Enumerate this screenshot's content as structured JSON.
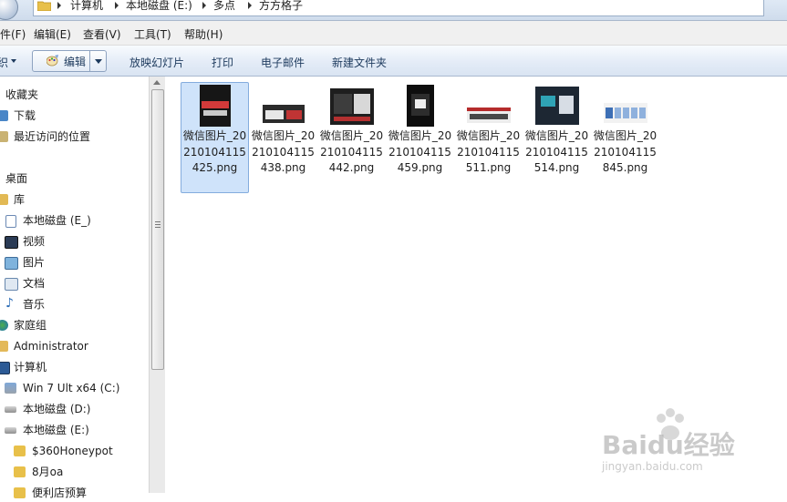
{
  "breadcrumb": [
    "计算机",
    "本地磁盘 (E:)",
    "多点",
    "方方格子"
  ],
  "menu": [
    "件(F)",
    "编辑(E)",
    "查看(V)",
    "工具(T)",
    "帮助(H)"
  ],
  "commands": {
    "left_cut": "织",
    "edit": "编辑",
    "slideshow": "放映幻灯片",
    "print": "打印",
    "email": "电子邮件",
    "newfolder": "新建文件夹"
  },
  "nav": [
    {
      "label": "收藏夹",
      "icon": "favorites-star-icon"
    },
    {
      "label": "下载",
      "icon": "downloads-icon"
    },
    {
      "label": "最近访问的位置",
      "icon": "recent-places-icon"
    },
    {
      "label": "桌面",
      "icon": "desktop-icon"
    },
    {
      "label": "库",
      "icon": "library-icon"
    },
    {
      "label": "本地磁盘 (E_)",
      "icon": "drive-link-icon"
    },
    {
      "label": "视频",
      "icon": "video-library-icon"
    },
    {
      "label": "图片",
      "icon": "pictures-library-icon"
    },
    {
      "label": "文档",
      "icon": "documents-library-icon"
    },
    {
      "label": "音乐",
      "icon": "music-library-icon"
    },
    {
      "label": "家庭组",
      "icon": "homegroup-icon"
    },
    {
      "label": "Administrator",
      "icon": "user-folder-icon"
    },
    {
      "label": "计算机",
      "icon": "computer-icon"
    },
    {
      "label": "Win 7 Ult x64 (C:)",
      "icon": "system-drive-icon"
    },
    {
      "label": "本地磁盘 (D:)",
      "icon": "hard-drive-icon"
    },
    {
      "label": "本地磁盘 (E:)",
      "icon": "hard-drive-icon"
    },
    {
      "label": "$360Honeypot",
      "icon": "folder-icon"
    },
    {
      "label": "8月oa",
      "icon": "folder-icon"
    },
    {
      "label": "便利店预算",
      "icon": "folder-icon"
    }
  ],
  "files": [
    {
      "name": "微信图片_20210104115425.png",
      "selected": true
    },
    {
      "name": "微信图片_20210104115438.png",
      "selected": false
    },
    {
      "name": "微信图片_20210104115442.png",
      "selected": false
    },
    {
      "name": "微信图片_20210104115459.png",
      "selected": false
    },
    {
      "name": "微信图片_20210104115511.png",
      "selected": false
    },
    {
      "name": "微信图片_20210104115514.png",
      "selected": false
    },
    {
      "name": "微信图片_20210104115845.png",
      "selected": false
    }
  ],
  "watermark": {
    "brand": "Baidu经验",
    "url": "jingyan.baidu.com"
  },
  "colors": {
    "selection": "#cfe3fa",
    "selection_border": "#84acdd",
    "folder": "#e8c04a"
  }
}
